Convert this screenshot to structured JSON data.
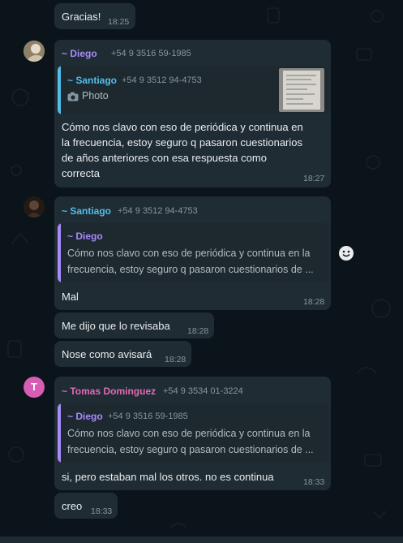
{
  "colors": {
    "background": "#0b141a",
    "bubble": "#202c33",
    "quote_bg": "#1d282f",
    "diego": "#a78bfa",
    "santiago": "#53bdeb",
    "tomas": "#e26ab6"
  },
  "messages": {
    "m1": {
      "text": "Gracias!",
      "time": "18:25"
    },
    "m2": {
      "sender": "~ Diego",
      "phone": "+54 9 3516 59-1985",
      "quote_sender": "~ Santiago",
      "quote_phone": "+54 9 3512 94-4753",
      "quote_media": "Photo",
      "quote_media_icon": "camera-icon",
      "lines": [
        "Cómo nos clavo con eso de periódica y continua en",
        "la frecuencia, estoy seguro q pasaron cuestionarios",
        "de años anteriores con esa respuesta como",
        "correcta"
      ],
      "time": "18:27"
    },
    "m3": {
      "sender": "~ Santiago",
      "phone": "+54 9 3512 94-4753",
      "quote_sender": "~ Diego",
      "quote_phone": "+54 9 3516 59-1985",
      "quote_lines": [
        "Cómo nos clavo con eso de periódica y continua en la",
        "frecuencia, estoy seguro q pasaron cuestionarios de ..."
      ],
      "text": "Mal",
      "time": "18:28"
    },
    "m4": {
      "text": "Me dijo que lo revisaba",
      "time": "18:28"
    },
    "m5": {
      "text": "Nose como avisará",
      "time": "18:28"
    },
    "m6": {
      "avatar_letter": "T",
      "sender": "~ Tomas Dominguez",
      "phone": "+54 9 3534 01-3224",
      "quote_sender": "~ Diego",
      "quote_phone": "+54 9 3516 59-1985",
      "quote_lines": [
        "Cómo nos clavo con eso de periódica y continua en la",
        "frecuencia, estoy seguro q pasaron cuestionarios de ..."
      ],
      "text": "si, pero estaban mal los otros. no es continua",
      "time": "18:33"
    },
    "m7": {
      "text": "creo",
      "time": "18:33"
    }
  }
}
